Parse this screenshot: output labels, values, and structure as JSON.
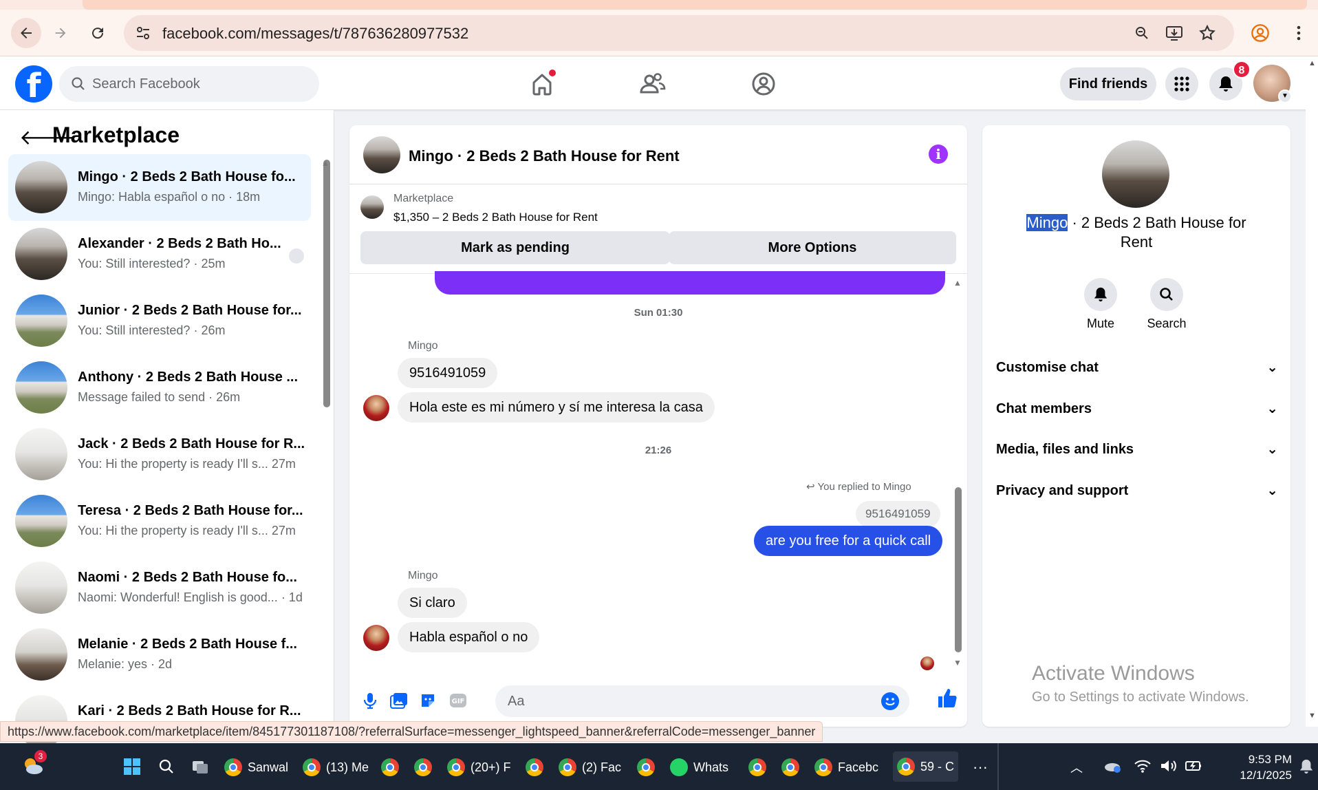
{
  "browser": {
    "url": "facebook.com/messages/t/787636280977532"
  },
  "fb_header": {
    "search_placeholder": "Search Facebook",
    "find_friends": "Find friends",
    "notification_count": "8"
  },
  "left_panel": {
    "title": "Marketplace",
    "conversations": [
      {
        "name": "Mingo · 2 Beds 2 Bath House fo...",
        "preview": "Mingo: Habla español o no · 18m",
        "thumb": "indoor"
      },
      {
        "name": "Alexander · 2 Beds 2 Bath Ho...",
        "preview": "You: Still interested? · 25m",
        "thumb": "indoor"
      },
      {
        "name": "Junior · 2 Beds 2 Bath House for...",
        "preview": "You: Still interested? · 26m",
        "thumb": "outdoor"
      },
      {
        "name": "Anthony · 2 Beds 2 Bath House ...",
        "preview": "Message failed to send · 26m",
        "thumb": "outdoor"
      },
      {
        "name": "Jack · 2 Beds 2 Bath House for R...",
        "preview": "You: Hi the property is ready I'll s...  27m",
        "thumb": "white"
      },
      {
        "name": "Teresa · 2 Beds 2 Bath House for...",
        "preview": "You: Hi the property is ready I'll s...  27m",
        "thumb": "outdoor"
      },
      {
        "name": "Naomi · 2 Beds 2 Bath House fo...",
        "preview": "Naomi: Wonderful! English is good... · 1d",
        "thumb": "white"
      },
      {
        "name": "Melanie · 2 Beds 2 Bath House f...",
        "preview": "Melanie: yes · 2d",
        "thumb": "dark"
      },
      {
        "name": "Kari · 2 Beds 2 Bath House for R...",
        "preview": "",
        "thumb": "white"
      }
    ]
  },
  "chat": {
    "title": "Mingo · 2 Beds 2 Bath House for Rent",
    "marketplace_label": "Marketplace",
    "listing": "$1,350 – 2 Beds 2 Bath House for Rent",
    "mark_pending": "Mark as pending",
    "more_options": "More Options",
    "timestamp_1": "Sun 01:30",
    "sender_1": "Mingo",
    "msg_1": "9516491059",
    "msg_2": "Hola este es mi número y sí me interesa la casa",
    "timestamp_2": "21:26",
    "replied_note": "You replied to Mingo",
    "quoted": "9516491059",
    "msg_3": "are you free for a quick call",
    "sender_2": "Mingo",
    "msg_4": "Si claro",
    "msg_5": "Habla español o no",
    "composer_placeholder": "Aa"
  },
  "right_panel": {
    "title_selected": "Mingo",
    "title_rest": " · 2 Beds 2 Bath House for Rent",
    "mute": "Mute",
    "search": "Search",
    "rows": [
      "Customise chat",
      "Chat members",
      "Media, files and links",
      "Privacy and support"
    ],
    "activate_title": "Activate Windows",
    "activate_sub": "Go to Settings to activate Windows."
  },
  "status_url": "https://www.facebook.com/marketplace/item/845177301187108/?referralSurface=messenger_lightspeed_banner&referralCode=messenger_banner",
  "taskbar": {
    "weather_badge": "3",
    "items": [
      "Sanwal",
      "(13) Me",
      "(20+) F",
      "(2) Fac",
      "Whats",
      "Facebc",
      "59 - C"
    ],
    "time": "9:53 PM",
    "date": "12/1/2025"
  },
  "colors": {
    "fb_blue": "#0866ff",
    "outgoing_bubble": "#2750e6",
    "info_purple": "#a033ff",
    "notification_red": "#e41e3f"
  }
}
